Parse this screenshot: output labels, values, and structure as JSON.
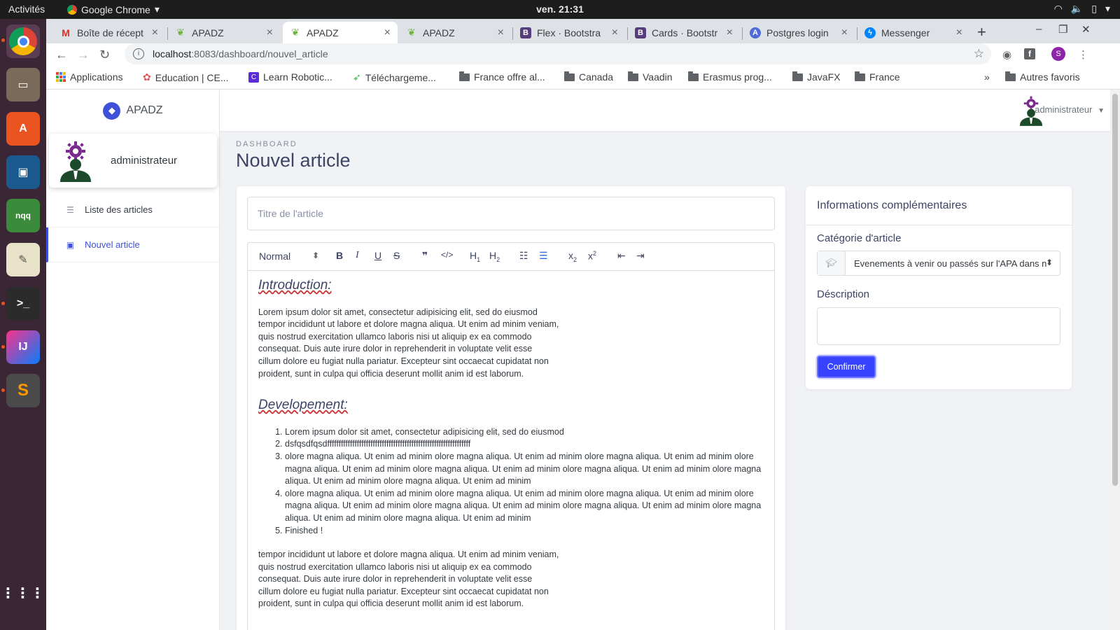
{
  "os": {
    "activities": "Activités",
    "app_name": "Google Chrome",
    "clock": "ven. 21:31"
  },
  "tabs": [
    {
      "label": "Boîte de récept",
      "icon": "gmail-icon",
      "color": "#d93025"
    },
    {
      "label": "APADZ",
      "icon": "leaf-icon",
      "color": "#6db33f"
    },
    {
      "label": "APADZ",
      "icon": "leaf-icon",
      "color": "#6db33f"
    },
    {
      "label": "APADZ",
      "icon": "leaf-icon",
      "color": "#6db33f"
    },
    {
      "label": "Flex · Bootstra",
      "icon": "bootstrap-icon",
      "color": "#563d7c"
    },
    {
      "label": "Cards · Bootstr",
      "icon": "bootstrap-icon",
      "color": "#563d7c"
    },
    {
      "label": "Postgres login",
      "icon": "auth-icon",
      "color": "#4f6bd8"
    },
    {
      "label": "Messenger",
      "icon": "messenger-icon",
      "color": "#0084ff"
    }
  ],
  "address": {
    "host": "localhost",
    "path": ":8083/dashboard/nouvel_article"
  },
  "bookmarks": [
    "Applications",
    "Education | CE...",
    "Learn Robotic...",
    "Téléchargeme...",
    "France offre al...",
    "Canada",
    "Vaadin",
    "Erasmus prog...",
    "JavaFX",
    "France"
  ],
  "bookmarks_more": "»",
  "bookmarks_other": "Autres favoris",
  "app": {
    "brand": "APADZ",
    "user_name": "administrateur",
    "header_user": "administrateur",
    "breadcrumb": "DASHBOARD",
    "page_title": "Nouvel article",
    "accent_color": "#3f51d8",
    "sidebar": [
      {
        "label": "Liste des articles",
        "icon": "list-icon",
        "active": false
      },
      {
        "label": "Nouvel article",
        "icon": "file-add-icon",
        "active": true
      }
    ]
  },
  "editor": {
    "title_placeholder": "Titre de l'article",
    "format_select": "Normal",
    "intro_heading": "Introduction:",
    "intro_text": "Lorem ipsum dolor sit amet, consectetur adipisicing elit, sed do eiusmod\ntempor incididunt ut labore et dolore magna aliqua. Ut enim ad minim veniam,\nquis nostrud exercitation ullamco laboris nisi ut aliquip ex ea commodo\nconsequat. Duis aute irure dolor in reprehenderit in voluptate velit esse\ncillum dolore eu fugiat nulla pariatur. Excepteur sint occaecat cupidatat non\nproident, sunt in culpa qui officia deserunt mollit anim id est laborum.",
    "dev_heading": "Developement:",
    "list": [
      "Lorem ipsum dolor sit amet, consectetur adipisicing elit, sed do eiusmod",
      "dsfqsdfqsdfffffffffffffffffffffffffffffffffffffffffffffffffffffffffffffff",
      "olore magna aliqua. Ut enim ad minim olore magna aliqua. Ut enim ad minim olore magna aliqua. Ut enim ad minim olore magna aliqua. Ut enim ad minim olore magna aliqua. Ut enim ad minim olore magna aliqua. Ut enim ad minim olore magna aliqua. Ut enim ad minim olore magna aliqua. Ut enim ad minim",
      "olore magna aliqua. Ut enim ad minim olore magna aliqua. Ut enim ad minim olore magna aliqua. Ut enim ad minim olore magna aliqua. Ut enim ad minim olore magna aliqua. Ut enim ad minim olore magna aliqua. Ut enim ad minim olore magna aliqua. Ut enim ad minim olore magna aliqua. Ut enim ad minim",
      "Finished !"
    ],
    "outro_text": "tempor incididunt ut labore et dolore magna aliqua. Ut enim ad minim veniam,\nquis nostrud exercitation ullamco laboris nisi ut aliquip ex ea commodo\nconsequat. Duis aute irure dolor in reprehenderit in voluptate velit esse\ncillum dolore eu fugiat nulla pariatur. Excepteur sint occaecat cupidatat non\nproident, sunt in culpa qui officia deserunt mollit anim id est laborum."
  },
  "side_panel": {
    "title": "Informations complémentaires",
    "category_label": "Catégorie d'article",
    "category_value": "Evenements à venir ou passés sur l'APA dans n",
    "description_label": "Déscription",
    "description_value": "",
    "confirm_label": "Confirmer"
  }
}
